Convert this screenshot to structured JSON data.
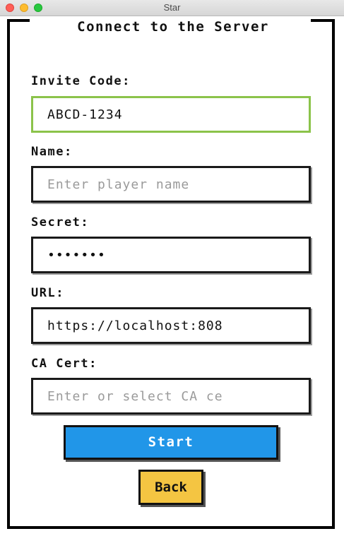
{
  "window": {
    "title": "Star"
  },
  "form": {
    "heading": "Connect to the Server",
    "invite_code": {
      "label": "Invite Code:",
      "value": "ABCD-1234",
      "placeholder": ""
    },
    "name": {
      "label": "Name:",
      "value": "",
      "placeholder": "Enter player name"
    },
    "secret": {
      "label": "Secret:",
      "value": "•••••••",
      "placeholder": ""
    },
    "url": {
      "label": "URL:",
      "value": "https://localhost:808",
      "placeholder": ""
    },
    "ca_cert": {
      "label": "CA Cert:",
      "value": "",
      "placeholder": "Enter or select CA ce"
    }
  },
  "buttons": {
    "start": "Start",
    "back": "Back"
  },
  "colors": {
    "start_bg": "#2196e8",
    "back_bg": "#f4c542",
    "active_border": "#8bc34a"
  }
}
